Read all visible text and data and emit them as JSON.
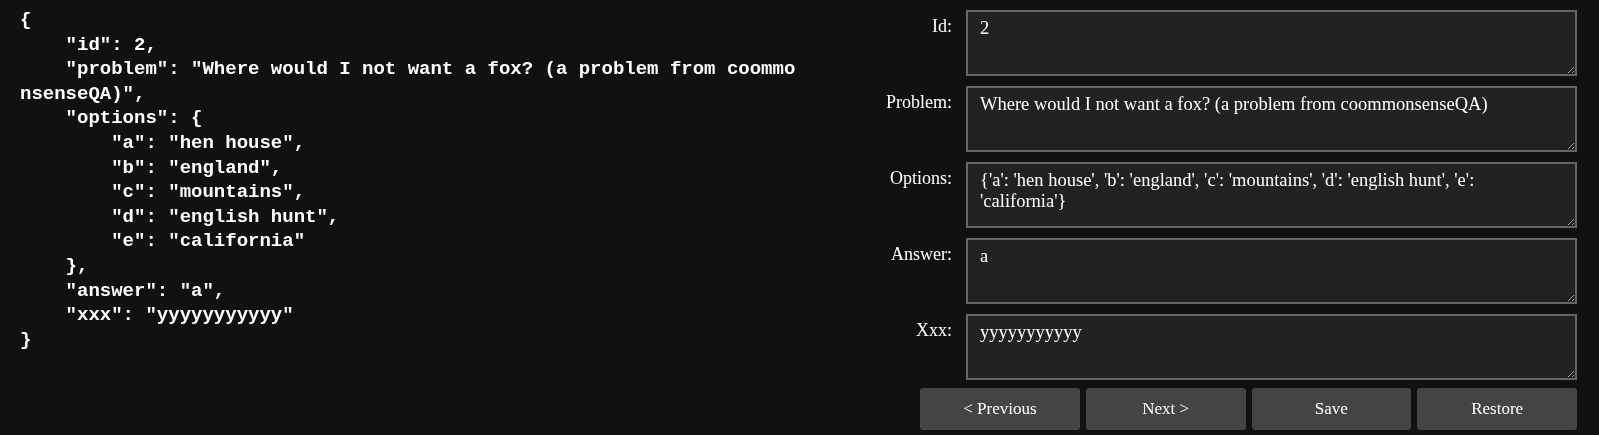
{
  "code_lines": [
    "{",
    "    \"id\": 2,",
    "    \"problem\": \"Where would I not want a fox? (a problem from coommonsenseQA)\",",
    "    \"options\": {",
    "        \"a\": \"hen house\",",
    "        \"b\": \"england\",",
    "        \"c\": \"mountains\",",
    "        \"d\": \"english hunt\",",
    "        \"e\": \"california\"",
    "    },",
    "    \"answer\": \"a\",",
    "    \"xxx\": \"yyyyyyyyyyy\"",
    "}"
  ],
  "fields": [
    {
      "label": "Id:",
      "value": "2"
    },
    {
      "label": "Problem:",
      "value": "Where would I not want a fox? (a problem from coommonsenseQA)"
    },
    {
      "label": "Options:",
      "value": "{'a': 'hen house', 'b': 'england', 'c': 'mountains', 'd': 'english hunt', 'e': 'california'}"
    },
    {
      "label": "Answer:",
      "value": "a"
    },
    {
      "label": "Xxx:",
      "value": "yyyyyyyyyyy"
    }
  ],
  "buttons": [
    "< Previous",
    "Next >",
    "Save",
    "Restore"
  ]
}
